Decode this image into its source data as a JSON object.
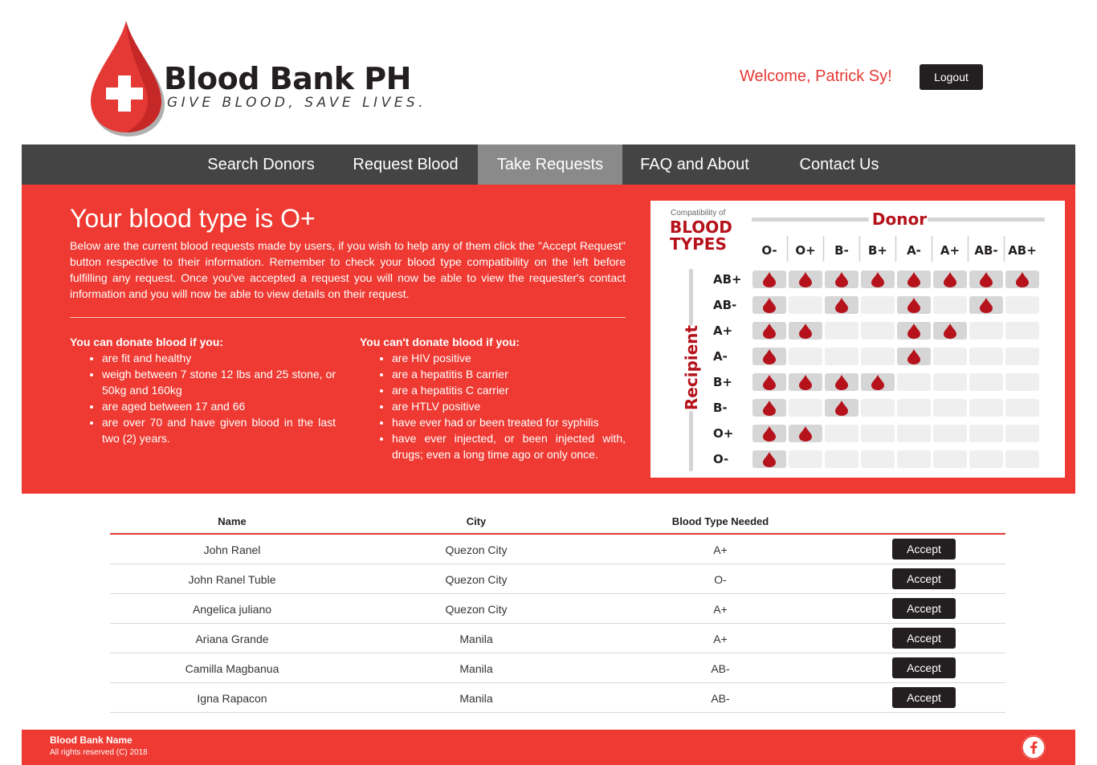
{
  "brand": {
    "title": "Blood Bank PH",
    "tagline": "GIVE BLOOD, SAVE LIVES.",
    "color": "#e53935"
  },
  "header": {
    "welcome": "Welcome, Patrick Sy!",
    "logout_label": "Logout"
  },
  "nav": {
    "items": [
      {
        "label": "Search Donors",
        "active": false
      },
      {
        "label": "Request Blood",
        "active": false
      },
      {
        "label": "Take Requests",
        "active": true
      },
      {
        "label": "FAQ and About",
        "active": false
      },
      {
        "label": "Contact Us",
        "active": false
      }
    ]
  },
  "panel": {
    "title": "Your blood type is O+",
    "description": "Below are the current blood requests made by users, if you wish to help any of them click the \"Accept Request\" button respective to their information. Remember to check your blood type compatibility on the left before fulfilling any request. Once you've accepted a request you will now be able to view the requester's contact information and you will now be able to view details on their request.",
    "can_donate": {
      "heading": "You can donate blood if you:",
      "items": [
        "are fit and healthy",
        "weigh between 7 stone 12 lbs and 25 stone, or 50kg and 160kg",
        "are aged between 17 and 66",
        "are over 70 and have given blood in the last two (2) years."
      ]
    },
    "cant_donate": {
      "heading": "You can't donate blood if you:",
      "items": [
        "are HIV positive",
        "are a hepatitis B carrier",
        "are a hepatitis C carrier",
        "are HTLV positive",
        "have ever had or been treated for syphilis",
        "have ever injected, or been injected with, drugs; even a long time ago or only once."
      ]
    }
  },
  "compat_chart": {
    "small_title": "Compatibility of",
    "title_line1": "BLOOD",
    "title_line2": "TYPES",
    "donor_label": "Donor",
    "recipient_label": "Recipient",
    "donor_types": [
      "O-",
      "O+",
      "B-",
      "B+",
      "A-",
      "A+",
      "AB-",
      "AB+"
    ],
    "recipient_types": [
      "AB+",
      "AB-",
      "A+",
      "A-",
      "B+",
      "B-",
      "O+",
      "O-"
    ],
    "matrix": [
      [
        1,
        1,
        1,
        1,
        1,
        1,
        1,
        1
      ],
      [
        1,
        0,
        1,
        0,
        1,
        0,
        1,
        0
      ],
      [
        1,
        1,
        0,
        0,
        1,
        1,
        0,
        0
      ],
      [
        1,
        0,
        0,
        0,
        1,
        0,
        0,
        0
      ],
      [
        1,
        1,
        1,
        1,
        0,
        0,
        0,
        0
      ],
      [
        1,
        0,
        1,
        0,
        0,
        0,
        0,
        0
      ],
      [
        1,
        1,
        0,
        0,
        0,
        0,
        0,
        0
      ],
      [
        1,
        0,
        0,
        0,
        0,
        0,
        0,
        0
      ]
    ],
    "drop_color": "#b5121b",
    "title_color": "#b5121b"
  },
  "table": {
    "headers": [
      "Name",
      "City",
      "Blood Type Needed"
    ],
    "accept_label": "Accept",
    "rows": [
      {
        "name": "John Ranel",
        "city": "Quezon City",
        "blood_type": "A+"
      },
      {
        "name": "John Ranel Tuble",
        "city": "Quezon City",
        "blood_type": "O-"
      },
      {
        "name": "Angelica juliano",
        "city": "Quezon City",
        "blood_type": "A+"
      },
      {
        "name": "Ariana Grande",
        "city": "Manila",
        "blood_type": "A+"
      },
      {
        "name": "Camilla Magbanua",
        "city": "Manila",
        "blood_type": "AB-"
      },
      {
        "name": "Igna Rapacon",
        "city": "Manila",
        "blood_type": "AB-"
      }
    ]
  },
  "footer": {
    "name": "Blood Bank Name",
    "copyright": "All rights reserved (C) 2018",
    "social_icon": "facebook-icon"
  }
}
